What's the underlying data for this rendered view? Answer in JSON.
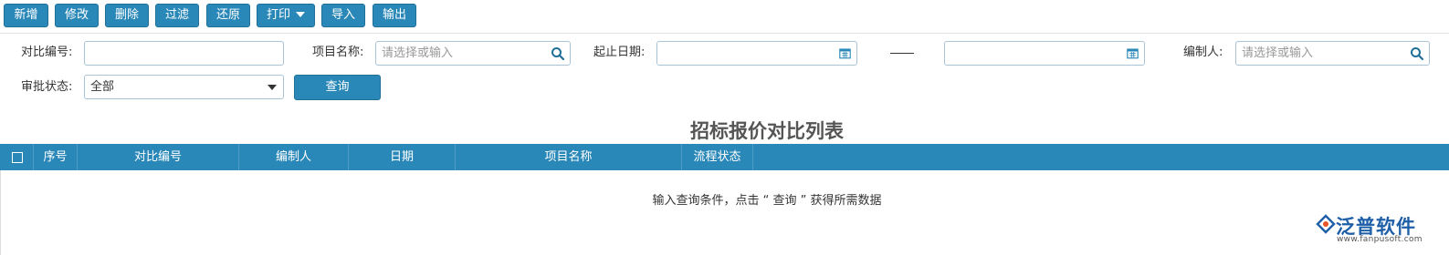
{
  "toolbar": {
    "add": "新增",
    "edit": "修改",
    "delete": "删除",
    "filter": "过滤",
    "restore": "还原",
    "print": "打印",
    "import": "导入",
    "export": "输出"
  },
  "search": {
    "compare_no_label": "对比编号:",
    "compare_no_value": "",
    "project_name_label": "项目名称:",
    "project_name_placeholder": "请选择或输入",
    "date_label": "起止日期:",
    "date_separator": "——",
    "author_label": "编制人:",
    "author_placeholder": "请选择或输入",
    "status_label": "审批状态:",
    "status_value": "全部",
    "query_button": "查询"
  },
  "list": {
    "title": "招标报价对比列表",
    "columns": [
      "序号",
      "对比编号",
      "编制人",
      "日期",
      "项目名称",
      "流程状态"
    ],
    "empty_message": "输入查询条件，点击 “ 查询 ” 获得所需数据"
  },
  "logo": {
    "brand": "泛普软件",
    "url": "www.fanpusoft.com"
  },
  "colors": {
    "accent": "#2a88b9",
    "brand": "#1e5fa8"
  }
}
